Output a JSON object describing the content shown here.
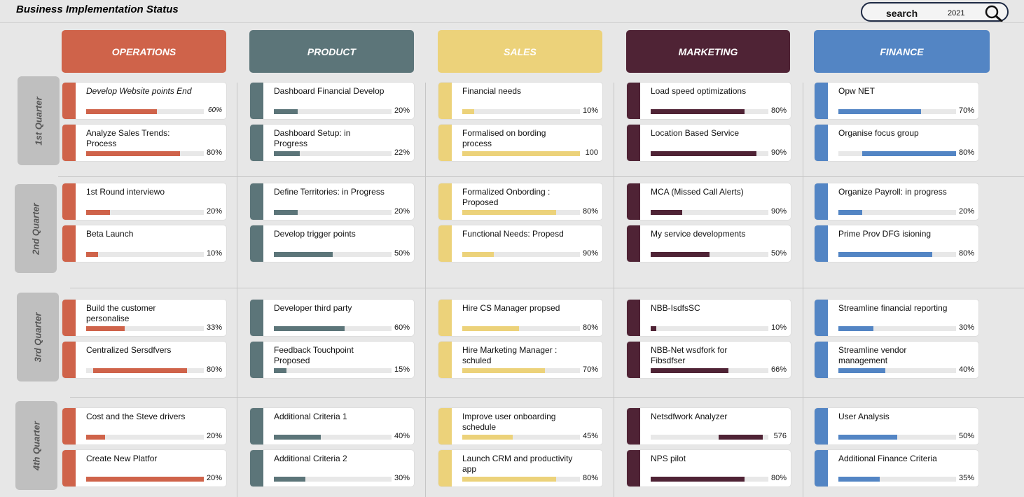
{
  "title": "Business Implementation Status",
  "search": {
    "label": "search",
    "year": "2021",
    "icon": "magnifier-icon"
  },
  "departments": [
    {
      "name": "OPERATIONS",
      "color": "#cf634a"
    },
    {
      "name": "PRODUCT",
      "color": "#5c7579"
    },
    {
      "name": "SALES",
      "color": "#ecd27a"
    },
    {
      "name": "MARKETING",
      "color": "#4f2335"
    },
    {
      "name": "FINANCE",
      "color": "#5385c4"
    }
  ],
  "quarters": [
    "1st Quarter",
    "2nd Quarter",
    "3rd Quarter",
    "4th Quarter"
  ],
  "grid": [
    [
      [
        {
          "name": "Develop Website points End",
          "progress": 0.6,
          "label": "60%",
          "italic": true
        },
        {
          "name": "Analyze Sales Trends: Process",
          "progress": 0.8,
          "label": "80%"
        }
      ],
      [
        {
          "name": "Dashboard Financial Develop",
          "progress": 0.2,
          "label": "20%"
        },
        {
          "name": "Dashboard Setup: in Progress",
          "progress": 0.22,
          "label": "22%"
        }
      ],
      [
        {
          "name": "Financial needs",
          "progress": 0.1,
          "label": "10%"
        },
        {
          "name": "Formalised on bording process",
          "progress": 1.0,
          "label": "100"
        }
      ],
      [
        {
          "name": "Load speed optimizations",
          "progress": 0.8,
          "label": "80%"
        },
        {
          "name": "Location Based Service",
          "progress": 0.9,
          "label": "90%"
        }
      ],
      [
        {
          "name": "Opw NET",
          "progress": 0.7,
          "label": "70%"
        },
        {
          "name": "Organise focus group",
          "progress": 0.8,
          "label": "80%",
          "offset": 0.2
        }
      ]
    ],
    [
      [
        {
          "name": "1st Round interviewo",
          "progress": 0.2,
          "label": "20%"
        },
        {
          "name": "Beta Launch",
          "progress": 0.1,
          "label": "10%"
        }
      ],
      [
        {
          "name": "Define Territories: in Progress",
          "progress": 0.2,
          "label": "20%"
        },
        {
          "name": "Develop trigger points",
          "progress": 0.5,
          "label": "50%"
        }
      ],
      [
        {
          "name": "Formalized Onbording : Proposed",
          "progress": 0.8,
          "label": "80%"
        },
        {
          "name": "Functional Needs: Propesd",
          "progress": 0.9,
          "label": "90%",
          "scale": 0.3
        }
      ],
      [
        {
          "name": "MCA (Missed Call Alerts)",
          "progress": 0.9,
          "label": "90%",
          "scale": 0.3
        },
        {
          "name": "My service developments",
          "progress": 0.5,
          "label": "50%"
        }
      ],
      [
        {
          "name": "Organize Payroll: in progress",
          "progress": 0.2,
          "label": "20%"
        },
        {
          "name": "Prime Prov DFG isioning",
          "progress": 0.8,
          "label": "80%"
        }
      ]
    ],
    [
      [
        {
          "name": "Build the customer personalise",
          "progress": 0.33,
          "label": "33%"
        },
        {
          "name": "Centralized Sersdfvers",
          "progress": 0.8,
          "label": "80%",
          "offset": 0.06
        }
      ],
      [
        {
          "name": "Developer third party",
          "progress": 0.6,
          "label": "60%"
        },
        {
          "name": "Feedback Touchpoint Proposed",
          "progress": 0.15,
          "label": "15%",
          "scale": 0.7
        }
      ],
      [
        {
          "name": "Hire CS Manager propsed",
          "progress": 0.8,
          "label": "80%",
          "scale": 0.6
        },
        {
          "name": "Hire Marketing Manager : schuled",
          "progress": 0.7,
          "label": "70%"
        }
      ],
      [
        {
          "name": "NBB-IsdfsSC",
          "progress": 0.1,
          "label": "10%",
          "scale": 0.5
        },
        {
          "name": "NBB-Net wsdfork for Fibsdfser",
          "progress": 0.66,
          "label": "66%"
        }
      ],
      [
        {
          "name": "Streamline financial reporting",
          "progress": 0.3,
          "label": "30%"
        },
        {
          "name": "Streamline vendor management",
          "progress": 0.4,
          "label": "40%"
        }
      ]
    ],
    [
      [
        {
          "name": "Cost and the Steve drivers",
          "progress": 0.2,
          "label": "20%",
          "scale": 0.8
        },
        {
          "name": "Create New Platfor",
          "progress": 0.2,
          "label": "20%",
          "scale": 5.0
        }
      ],
      [
        {
          "name": "Additional Criteria 1",
          "progress": 0.4,
          "label": "40%"
        },
        {
          "name": "Additional Criteria 2",
          "progress": 0.3,
          "label": "30%",
          "scale": 0.9
        }
      ],
      [
        {
          "name": "Improve user onboarding schedule",
          "progress": 0.45,
          "label": "45%",
          "scale": 0.95
        },
        {
          "name": "Launch CRM and productivity app",
          "progress": 0.8,
          "label": "80%"
        }
      ],
      [
        {
          "name": "Netsdfwork Analyzer",
          "progress": 0.37,
          "label": "576",
          "offset": 0.58
        },
        {
          "name": "NPS pilot",
          "progress": 0.8,
          "label": "80%"
        }
      ],
      [
        {
          "name": "User Analysis",
          "progress": 0.5,
          "label": "50%"
        },
        {
          "name": "Additional Finance Criteria",
          "progress": 0.35,
          "label": "35%",
          "scale": 1.0
        }
      ]
    ]
  ]
}
